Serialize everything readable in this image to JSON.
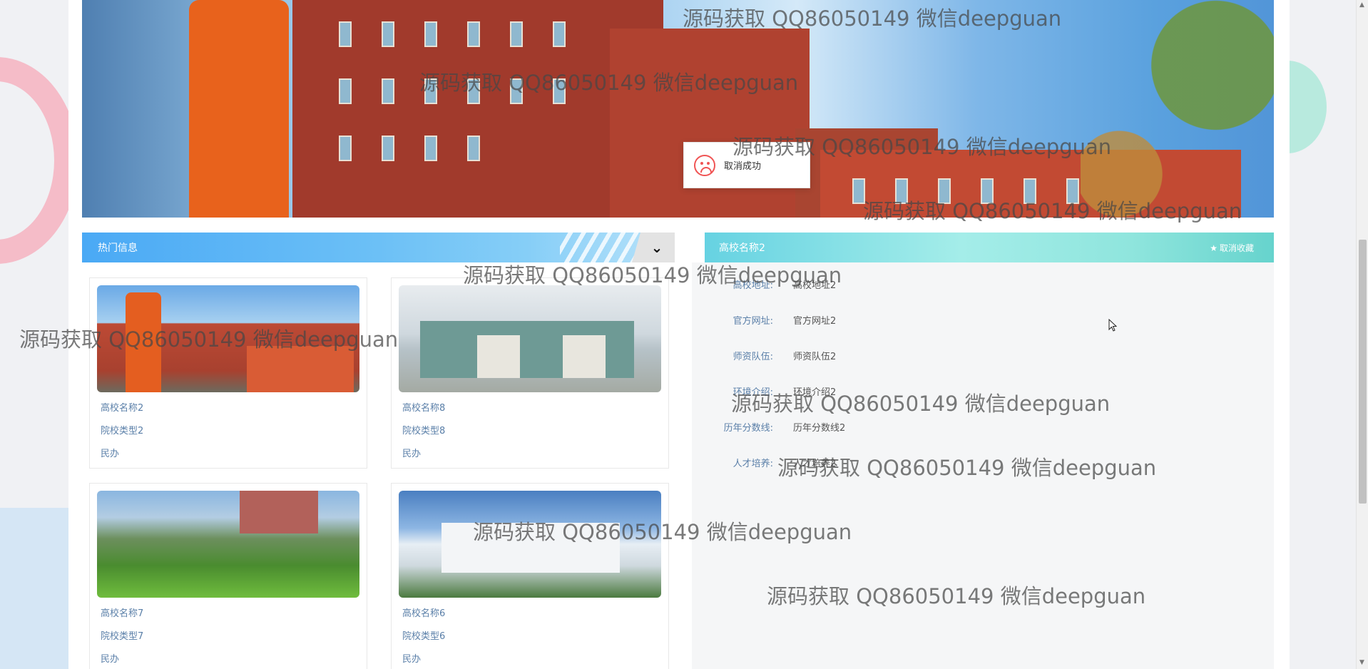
{
  "toast": {
    "message": "取消成功",
    "icon": "sad-face-icon"
  },
  "hot_section": {
    "title": "热门信息",
    "toggle_icon": "chevron-down-icon"
  },
  "cards": [
    {
      "name": "高校名称2",
      "type": "院校类型2",
      "nature": "民办"
    },
    {
      "name": "高校名称8",
      "type": "院校类型8",
      "nature": "民办"
    },
    {
      "name": "高校名称7",
      "type": "院校类型7",
      "nature": "民办"
    },
    {
      "name": "高校名称6",
      "type": "院校类型6",
      "nature": "民办"
    }
  ],
  "detail": {
    "title": "高校名称2",
    "unfavorite_label": "取消收藏",
    "unfavorite_icon": "star-icon",
    "rows": [
      {
        "label": "高校地址:",
        "value": "高校地址2"
      },
      {
        "label": "官方网址:",
        "value": "官方网址2"
      },
      {
        "label": "师资队伍:",
        "value": "师资队伍2"
      },
      {
        "label": "环境介绍:",
        "value": "环境介绍2"
      },
      {
        "label": "历年分数线:",
        "value": "历年分数线2"
      },
      {
        "label": "人才培养:",
        "value": "人才培养2"
      }
    ]
  },
  "watermark": "源码获取 QQ86050149 微信deepguan",
  "colors": {
    "hot_header": "#4aa9f5",
    "detail_header": "#66d2e2",
    "link_text": "#5a7fa8",
    "error_icon": "#f05454"
  }
}
